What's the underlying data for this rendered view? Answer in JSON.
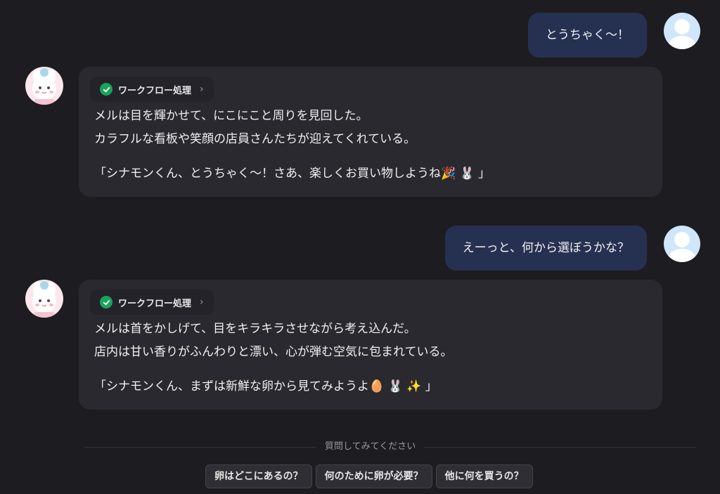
{
  "conversation": {
    "user_messages": [
      {
        "text": "とうちゃく〜！"
      },
      {
        "text": "えーっと、何から選ぼうかな？"
      }
    ],
    "bot_messages": [
      {
        "workflow_label": "ワークフロー処理",
        "line1": "メルは目を輝かせて、にこにこと周りを見回した。",
        "line2": "カラフルな看板や笑顔の店員さんたちが迎えてくれている。",
        "quote_text": "「シナモンくん、とうちゃく〜！さあ、楽しくお買い物しようね",
        "quote_emoji1": "🎉",
        "quote_emoji2": "🐰",
        "quote_close": "」"
      },
      {
        "workflow_label": "ワークフロー処理",
        "line1": "メルは首をかしげて、目をキラキラさせながら考え込んだ。",
        "line2": "店内は甘い香りがふんわりと漂い、心が弾む空気に包まれている。",
        "quote_text": "「シナモンくん、まずは新鮮な卵から見てみようよ",
        "quote_emoji1": "🥚",
        "quote_emoji2": "🐰",
        "quote_emoji3": "✨",
        "quote_close": "」"
      }
    ]
  },
  "suggestions": {
    "label": "質問してみてください",
    "chips": [
      "卵はどこにあるの？",
      "何のために卵が必要？",
      "他に何を買うの？"
    ]
  },
  "icons": {
    "workflow_status": "check-circle-icon",
    "workflow_expand": "chevron-right-icon",
    "user_avatar": "user-avatar-icon",
    "bot_avatar": "bunny-avatar-icon"
  },
  "colors": {
    "background": "#1d1c21",
    "user_bubble": "#263152",
    "bot_bubble": "#2a292f",
    "success": "#19a45b"
  }
}
